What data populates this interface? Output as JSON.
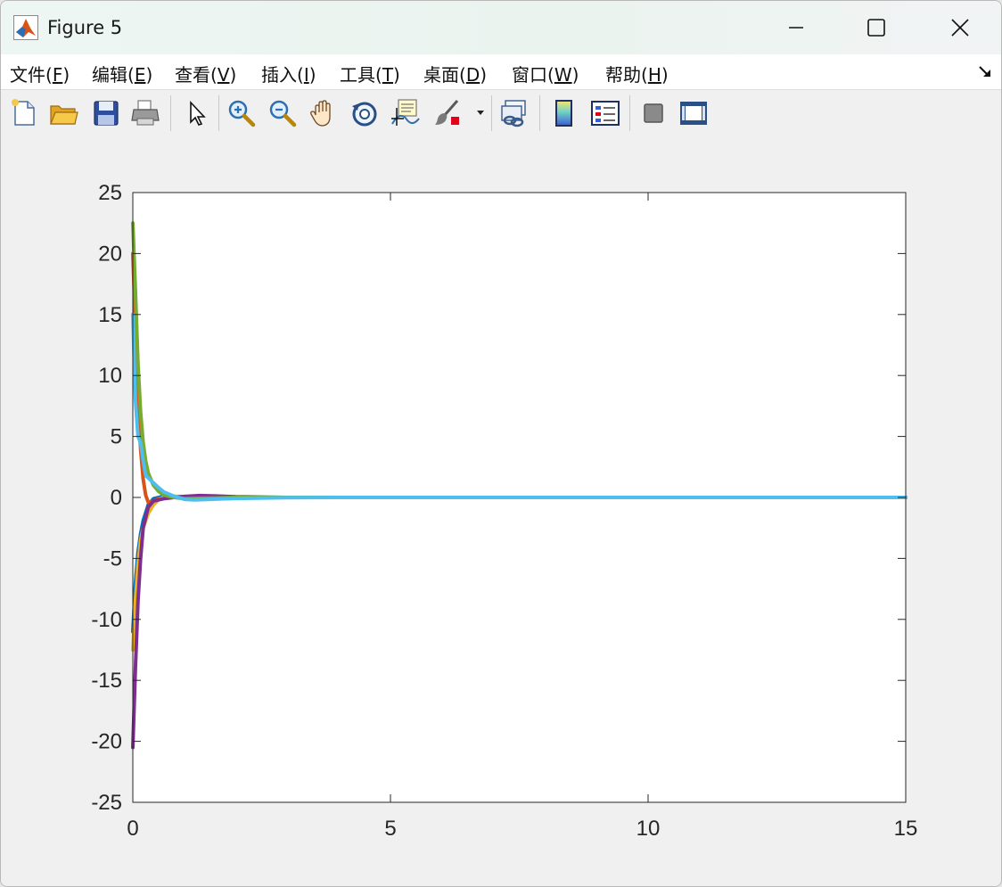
{
  "window": {
    "title": "Figure 5",
    "controls": [
      "minimize",
      "maximize",
      "close"
    ]
  },
  "menu": [
    {
      "text": "文件(",
      "acc": "F",
      "end": ")"
    },
    {
      "text": "编辑(",
      "acc": "E",
      "end": ")"
    },
    {
      "text": "查看(",
      "acc": "V",
      "end": ")"
    },
    {
      "text": "插入(",
      "acc": "I",
      "end": ")"
    },
    {
      "text": "工具(",
      "acc": "T",
      "end": ")"
    },
    {
      "text": "桌面(",
      "acc": "D",
      "end": ")"
    },
    {
      "text": "窗口(",
      "acc": "W",
      "end": ")"
    },
    {
      "text": "帮助(",
      "acc": "H",
      "end": ")"
    }
  ],
  "toolbar": {
    "tools": [
      "new-figure",
      "open-file",
      "save-figure",
      "print-figure",
      "edit-plot",
      "zoom-in",
      "zoom-out",
      "pan",
      "rotate-3d",
      "data-cursor",
      "brush",
      "link-plot",
      "insert-colorbar",
      "insert-legend",
      "hide-plot-tools",
      "show-plot-tools"
    ]
  },
  "colors": {
    "series": [
      "#0072BD",
      "#D95319",
      "#EDB120",
      "#7E2F8E",
      "#77AC30",
      "#4DBEEE"
    ]
  },
  "chart_data": {
    "type": "line",
    "xlim": [
      0,
      15
    ],
    "ylim": [
      -25,
      25
    ],
    "xticks": [
      0,
      5,
      10,
      15
    ],
    "yticks": [
      -25,
      -20,
      -15,
      -10,
      -5,
      0,
      5,
      10,
      15,
      20,
      25
    ],
    "grid": false,
    "legend": "none",
    "series": [
      {
        "color": "#0072BD",
        "x": [
          0,
          0.05,
          0.1,
          0.15,
          0.2,
          0.3,
          0.4,
          0.6,
          0.8,
          1.0,
          1.3,
          2,
          3,
          15
        ],
        "y": [
          -11,
          -7,
          -4.5,
          -3,
          -1.9,
          -0.6,
          -0.1,
          0.1,
          0.05,
          0,
          0,
          0,
          0,
          0
        ]
      },
      {
        "color": "#D95319",
        "x": [
          0,
          0.05,
          0.1,
          0.15,
          0.2,
          0.25,
          0.3,
          0.4,
          0.5,
          0.7,
          1.0,
          1.5,
          2,
          3,
          15
        ],
        "y": [
          20,
          14,
          8,
          4,
          1.5,
          0.2,
          -0.4,
          -0.3,
          -0.1,
          0,
          0,
          0,
          0,
          0,
          0
        ]
      },
      {
        "color": "#EDB120",
        "x": [
          0,
          0.05,
          0.1,
          0.15,
          0.2,
          0.3,
          0.4,
          0.5,
          0.6,
          0.8,
          1.0,
          1.5,
          2,
          3,
          15
        ],
        "y": [
          -12.5,
          -8.5,
          -5.5,
          -3.5,
          -2.5,
          -1.3,
          -0.6,
          -0.2,
          0,
          0.1,
          0.05,
          0,
          0,
          0,
          0
        ]
      },
      {
        "color": "#7E2F8E",
        "x": [
          0,
          0.05,
          0.1,
          0.15,
          0.2,
          0.3,
          0.4,
          0.5,
          0.6,
          0.8,
          1.0,
          1.3,
          1.6,
          2,
          3,
          15
        ],
        "y": [
          -20.5,
          -14,
          -8.5,
          -5,
          -2.5,
          -0.8,
          -0.3,
          -0.2,
          -0.1,
          0,
          0.08,
          0.15,
          0.12,
          0.05,
          0,
          0
        ]
      },
      {
        "color": "#77AC30",
        "x": [
          0,
          0.05,
          0.1,
          0.15,
          0.2,
          0.25,
          0.3,
          0.4,
          0.5,
          0.6,
          0.8,
          1.0,
          1.5,
          2,
          3,
          15
        ],
        "y": [
          22.5,
          17,
          11,
          7,
          4.5,
          3,
          2,
          1,
          0.5,
          0.2,
          0,
          -0.1,
          -0.05,
          0,
          0,
          0
        ]
      },
      {
        "color": "#4DBEEE",
        "x": [
          0,
          0.05,
          0.1,
          0.15,
          0.2,
          0.25,
          0.3,
          0.4,
          0.5,
          0.6,
          0.8,
          1.0,
          1.2,
          1.5,
          2,
          3,
          4,
          15
        ],
        "y": [
          15,
          8,
          5,
          4.5,
          3,
          1.8,
          1.6,
          1.2,
          0.8,
          0.45,
          0.1,
          -0.15,
          -0.2,
          -0.15,
          -0.08,
          -0.02,
          0,
          0
        ]
      }
    ]
  }
}
